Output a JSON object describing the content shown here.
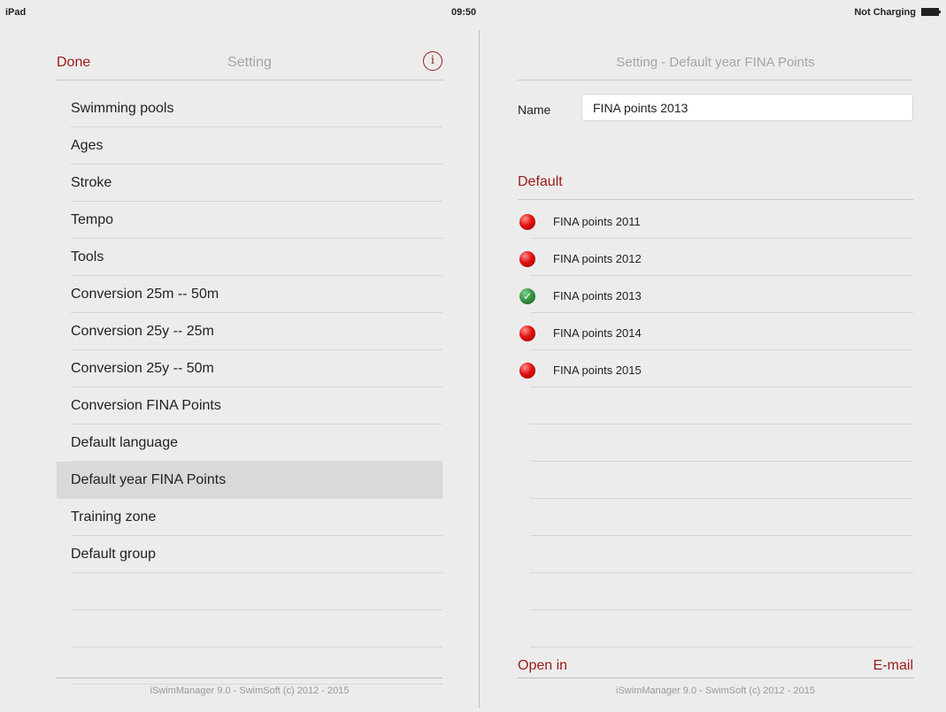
{
  "status_bar": {
    "device": "iPad",
    "time": "09:50",
    "charging": "Not Charging"
  },
  "left": {
    "done_label": "Done",
    "title": "Setting",
    "info_icon": "info-circle-icon",
    "items": [
      {
        "label": "Swimming pools"
      },
      {
        "label": "Ages"
      },
      {
        "label": "Stroke"
      },
      {
        "label": "Tempo"
      },
      {
        "label": "Tools"
      },
      {
        "label": "Conversion 25m -- 50m"
      },
      {
        "label": "Conversion 25y -- 25m"
      },
      {
        "label": "Conversion 25y -- 50m"
      },
      {
        "label": "Conversion FINA Points"
      },
      {
        "label": "Default language"
      },
      {
        "label": "Default year FINA Points",
        "selected": true
      },
      {
        "label": "Training zone"
      },
      {
        "label": "Default group"
      }
    ],
    "footer": "iSwimManager 9.0 - SwimSoft (c) 2012 - 2015"
  },
  "right": {
    "title": "Setting - Default year FINA Points",
    "name_label": "Name",
    "name_value": "FINA points 2013",
    "section_title": "Default",
    "options": [
      {
        "label": "FINA points 2011",
        "status": "red-dot-icon"
      },
      {
        "label": "FINA points 2012",
        "status": "red-dot-icon"
      },
      {
        "label": "FINA points 2013",
        "status": "green-check-icon",
        "selected": true
      },
      {
        "label": "FINA points 2014",
        "status": "red-dot-icon"
      },
      {
        "label": "FINA points 2015",
        "status": "red-dot-icon"
      }
    ],
    "open_in_label": "Open in",
    "email_label": "E-mail",
    "footer": "iSwimManager 9.0 - SwimSoft (c) 2012 - 2015"
  },
  "colors": {
    "accent": "#9a1b1b",
    "background": "#ececec",
    "selected_row": "#d9d9d9"
  }
}
